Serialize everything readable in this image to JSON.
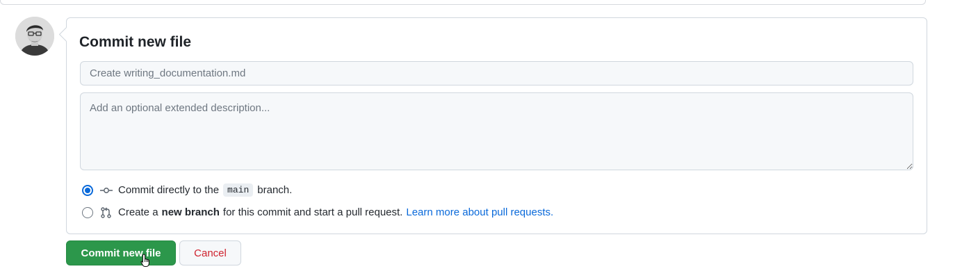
{
  "form": {
    "title": "Commit new file",
    "summary_placeholder": "Create writing_documentation.md",
    "description_placeholder": "Add an optional extended description..."
  },
  "options": {
    "direct": {
      "selected": true,
      "prefix": "Commit directly to the",
      "branch": "main",
      "suffix": "branch."
    },
    "new_branch": {
      "selected": false,
      "prefix": "Create a",
      "bold": "new branch",
      "suffix": "for this commit and start a pull request.",
      "link": "Learn more about pull requests."
    }
  },
  "actions": {
    "commit_label": "Commit new file",
    "cancel_label": "Cancel"
  },
  "colors": {
    "primary": "#2c974b",
    "link": "#0969da",
    "danger": "#cf222e"
  },
  "icons": {
    "commit": "git-commit-icon",
    "pull_request": "git-pull-request-icon",
    "cursor": "hand-pointer-cursor"
  }
}
